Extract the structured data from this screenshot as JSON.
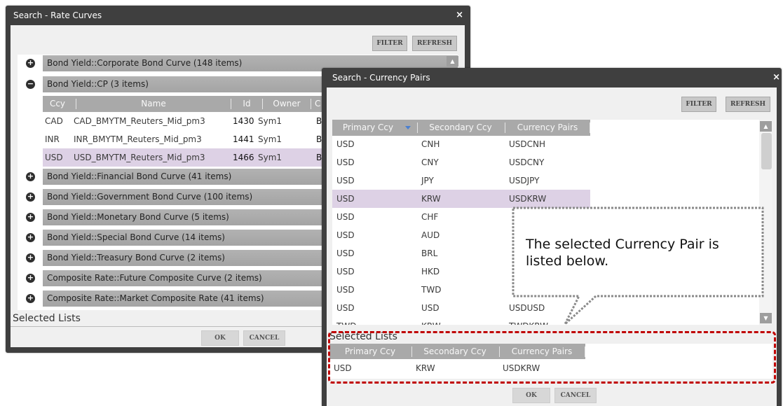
{
  "rate": {
    "title": "Search - Rate Curves",
    "close": "×",
    "filter": "FILTER",
    "refresh": "REFRESH",
    "groups_top": [
      {
        "toggle": "+",
        "label": "Bond Yield::Corporate Bond Curve (148 items)"
      },
      {
        "toggle": "−",
        "label": "Bond Yield::CP (3 items)"
      }
    ],
    "columns": [
      "Ccy",
      "Name",
      "Id",
      "Owner",
      "C"
    ],
    "rows": [
      {
        "ccy": "CAD",
        "name": "CAD_BMYTM_Reuters_Mid_pm3",
        "id": "1430",
        "owner": "Sym1",
        "c": "Bo"
      },
      {
        "ccy": "INR",
        "name": "INR_BMYTM_Reuters_Mid_pm3",
        "id": "1441",
        "owner": "Sym1",
        "c": "Bo"
      },
      {
        "ccy": "USD",
        "name": "USD_BMYTM_Reuters_Mid_pm3",
        "id": "1466",
        "owner": "Sym1",
        "c": "Bo"
      }
    ],
    "groups_bottom": [
      {
        "toggle": "+",
        "label": "Bond Yield::Financial Bond Curve (41 items)"
      },
      {
        "toggle": "+",
        "label": "Bond Yield::Government Bond Curve (100 items)"
      },
      {
        "toggle": "+",
        "label": "Bond Yield::Monetary Bond Curve (5 items)"
      },
      {
        "toggle": "+",
        "label": "Bond Yield::Special Bond Curve (14 items)"
      },
      {
        "toggle": "+",
        "label": "Bond Yield::Treasury Bond Curve (2 items)"
      },
      {
        "toggle": "+",
        "label": "Composite Rate::Future Composite Curve (2 items)"
      },
      {
        "toggle": "+",
        "label": "Composite Rate::Market Composite Rate (41 items)"
      }
    ],
    "selected_lists": "Selected Lists",
    "ok": "OK",
    "cancel": "CANCEL"
  },
  "currency": {
    "title": "Search - Currency Pairs",
    "close": "×",
    "filter": "FILTER",
    "refresh": "REFRESH",
    "columns": [
      "Primary Ccy",
      "Secondary Ccy",
      "Currency Pairs"
    ],
    "rows": [
      {
        "p": "USD",
        "s": "CNH",
        "pair": "USDCNH"
      },
      {
        "p": "USD",
        "s": "CNY",
        "pair": "USDCNY"
      },
      {
        "p": "USD",
        "s": "JPY",
        "pair": "USDJPY"
      },
      {
        "p": "USD",
        "s": "KRW",
        "pair": "USDKRW"
      },
      {
        "p": "USD",
        "s": "CHF",
        "pair": ""
      },
      {
        "p": "USD",
        "s": "AUD",
        "pair": ""
      },
      {
        "p": "USD",
        "s": "BRL",
        "pair": ""
      },
      {
        "p": "USD",
        "s": "HKD",
        "pair": ""
      },
      {
        "p": "USD",
        "s": "TWD",
        "pair": ""
      },
      {
        "p": "USD",
        "s": "USD",
        "pair": "USDUSD"
      },
      {
        "p": "TWD",
        "s": "KRW",
        "pair": "TWDKRW"
      }
    ],
    "selected_lists": "Selected Lists",
    "selected_columns": [
      "Primary Ccy",
      "Secondary Ccy",
      "Currency Pairs"
    ],
    "selected_row": {
      "p": "USD",
      "s": "KRW",
      "pair": "USDKRW"
    },
    "ok": "OK",
    "cancel": "CANCEL"
  },
  "callout": {
    "line1": "The selected Currency Pair is",
    "line2": "listed below."
  },
  "colors": {
    "selected_row": "#ddd1e5",
    "highlight_border": "#c00000",
    "title_bar": "#3f3f3f",
    "group_bar": "#a9a9a9"
  }
}
